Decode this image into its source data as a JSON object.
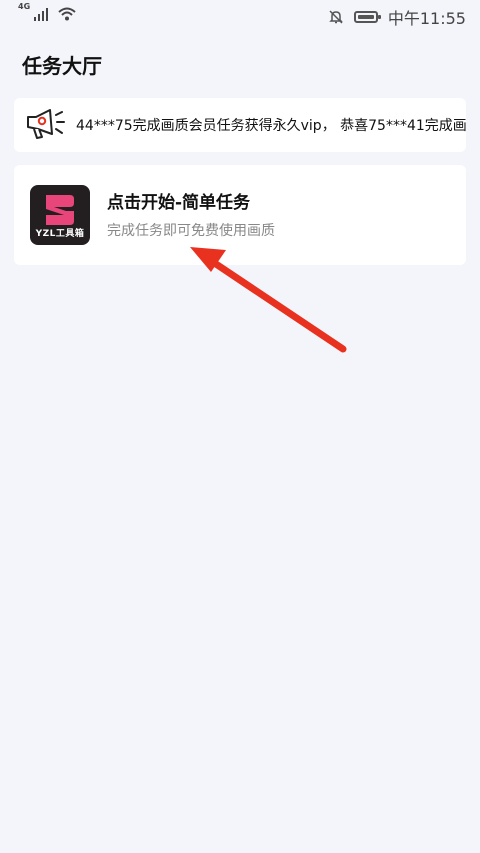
{
  "status_bar": {
    "network": "4G",
    "time": "中午11:55",
    "icons": [
      "signal-icon",
      "wifi-icon",
      "mute-bell-icon",
      "battery-icon"
    ]
  },
  "page": {
    "title": "任务大厅"
  },
  "notice": {
    "icon": "megaphone-icon",
    "text": "44***75完成画质会员任务获得永久vip， 恭喜75***41完成画"
  },
  "task": {
    "app_icon_label": "YZL工具箱",
    "title": "点击开始-简单任务",
    "subtitle": "完成任务即可免费使用画质"
  },
  "colors": {
    "background": "#f4f5fa",
    "card": "#ffffff",
    "arrow": "#e8321f",
    "logo_pink": "#e8457a",
    "app_icon_bg": "#231f20"
  }
}
